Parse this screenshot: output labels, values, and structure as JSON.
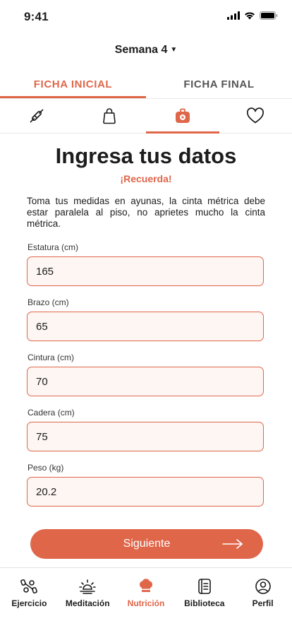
{
  "status": {
    "time": "9:41"
  },
  "header": {
    "week_label": "Semana 4"
  },
  "tabs": [
    {
      "label": "FICHA INICIAL",
      "active": true
    },
    {
      "label": "FICHA FINAL",
      "active": false
    }
  ],
  "icon_tabs": [
    {
      "icon": "rolling-pin-icon",
      "active": false
    },
    {
      "icon": "bag-icon",
      "active": false
    },
    {
      "icon": "measuring-tape-icon",
      "active": true
    },
    {
      "icon": "heart-icon",
      "active": false
    }
  ],
  "main": {
    "title": "Ingresa tus datos",
    "subtitle": "¡Recuerda!",
    "instructions": "Toma tus medidas en ayunas, la cinta métrica debe estar paralela al piso, no aprietes mucho la cinta métrica."
  },
  "form": {
    "fields": [
      {
        "label": "Estatura (cm)",
        "value": "165"
      },
      {
        "label": "Brazo (cm)",
        "value": "65"
      },
      {
        "label": "Cintura (cm)",
        "value": "70"
      },
      {
        "label": "Cadera (cm)",
        "value": "75"
      },
      {
        "label": "Peso (kg)",
        "value": "20.2"
      }
    ],
    "next_label": "Siguiente"
  },
  "bottom_nav": [
    {
      "label": "Ejercicio",
      "icon": "dumbbell-icon",
      "active": false
    },
    {
      "label": "Meditación",
      "icon": "sunrise-icon",
      "active": false
    },
    {
      "label": "Nutrición",
      "icon": "chef-hat-icon",
      "active": true
    },
    {
      "label": "Biblioteca",
      "icon": "book-icon",
      "active": false
    },
    {
      "label": "Perfil",
      "icon": "profile-icon",
      "active": false
    }
  ],
  "colors": {
    "accent": "#e0664a",
    "input_bg": "#fdf6f3"
  }
}
